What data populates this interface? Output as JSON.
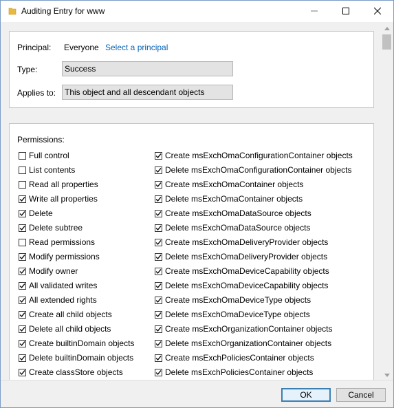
{
  "window": {
    "title": "Auditing Entry for www"
  },
  "principal": {
    "label": "Principal:",
    "value": "Everyone",
    "link": "Select a principal"
  },
  "type": {
    "label": "Type:",
    "value": "Success"
  },
  "applies_to": {
    "label": "Applies to:",
    "value": "This object and all descendant objects"
  },
  "permissions": {
    "title": "Permissions:",
    "left": [
      {
        "label": "Full control",
        "checked": false
      },
      {
        "label": "List contents",
        "checked": false
      },
      {
        "label": "Read all properties",
        "checked": false
      },
      {
        "label": "Write all properties",
        "checked": true
      },
      {
        "label": "Delete",
        "checked": true
      },
      {
        "label": "Delete subtree",
        "checked": true
      },
      {
        "label": "Read permissions",
        "checked": false
      },
      {
        "label": "Modify permissions",
        "checked": true
      },
      {
        "label": "Modify owner",
        "checked": true
      },
      {
        "label": "All validated writes",
        "checked": true
      },
      {
        "label": "All extended rights",
        "checked": true
      },
      {
        "label": "Create all child objects",
        "checked": true
      },
      {
        "label": "Delete all child objects",
        "checked": true
      },
      {
        "label": "Create builtinDomain objects",
        "checked": true
      },
      {
        "label": "Delete builtinDomain objects",
        "checked": true
      },
      {
        "label": "Create classStore objects",
        "checked": true
      }
    ],
    "right": [
      {
        "label": "Create msExchOmaConfigurationContainer objects",
        "checked": true
      },
      {
        "label": "Delete msExchOmaConfigurationContainer objects",
        "checked": true
      },
      {
        "label": "Create msExchOmaContainer objects",
        "checked": true
      },
      {
        "label": "Delete msExchOmaContainer objects",
        "checked": true
      },
      {
        "label": "Create msExchOmaDataSource objects",
        "checked": true
      },
      {
        "label": "Delete msExchOmaDataSource objects",
        "checked": true
      },
      {
        "label": "Create msExchOmaDeliveryProvider objects",
        "checked": true
      },
      {
        "label": "Delete msExchOmaDeliveryProvider objects",
        "checked": true
      },
      {
        "label": "Create msExchOmaDeviceCapability objects",
        "checked": true
      },
      {
        "label": "Delete msExchOmaDeviceCapability objects",
        "checked": true
      },
      {
        "label": "Create msExchOmaDeviceType objects",
        "checked": true
      },
      {
        "label": "Delete msExchOmaDeviceType objects",
        "checked": true
      },
      {
        "label": "Create msExchOrganizationContainer objects",
        "checked": true
      },
      {
        "label": "Delete msExchOrganizationContainer objects",
        "checked": true
      },
      {
        "label": "Create msExchPoliciesContainer objects",
        "checked": true
      },
      {
        "label": "Delete msExchPoliciesContainer objects",
        "checked": true
      }
    ]
  },
  "buttons": {
    "ok": "OK",
    "cancel": "Cancel"
  },
  "icons": {
    "app": "folder-icon",
    "minimize": "minimize-icon",
    "maximize": "maximize-icon",
    "close": "close-icon",
    "check": "checkmark-icon"
  },
  "colors": {
    "link": "#0a64b4",
    "ok_border": "#3c7fb1",
    "folder": "#e8b93c"
  }
}
